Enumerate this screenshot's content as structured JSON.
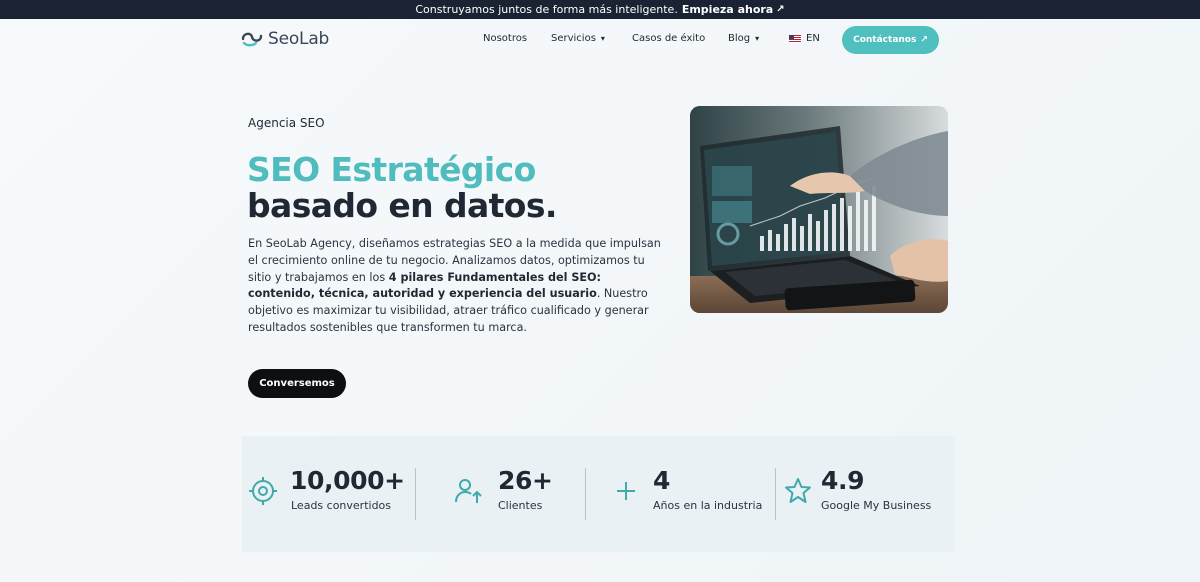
{
  "announcement": {
    "text": "Construyamos juntos de forma más inteligente.",
    "cta": "Empieza ahora",
    "cta_arrow": "↗"
  },
  "header": {
    "logo_text": "SeoLab",
    "nav": [
      {
        "label": "Nosotros"
      },
      {
        "label": "Servicios",
        "dropdown": true
      },
      {
        "label": "Casos de éxito"
      },
      {
        "label": "Blog",
        "dropdown": true
      }
    ],
    "language": "EN",
    "contact_label": "Contáctanos",
    "contact_arrow": "↗",
    "caret": "▾"
  },
  "hero": {
    "eyebrow": "Agencia SEO",
    "title_line1": "SEO Estratégico",
    "title_line2": "basado en datos.",
    "paragraph": {
      "part1": "En SeoLab Agency, diseñamos estrategias SEO a la medida que impulsan el crecimiento online de tu negocio. Analizamos datos, optimizamos tu sitio y trabajamos en los ",
      "bold": "4 pilares Fundamentales del SEO: contenido, técnica, autoridad y experiencia del usuario",
      "part2": ". Nuestro objetivo es maximizar tu visibilidad, atraer tráfico cualificado y generar resultados sostenibles que transformen tu marca."
    },
    "button": "Conversemos"
  },
  "stats": [
    {
      "value": "10,000+",
      "label": "Leads convertidos",
      "icon": "target-icon"
    },
    {
      "value": "26+",
      "label": "Clientes",
      "icon": "users-growth-icon"
    },
    {
      "value": "4",
      "label": "Años en la industria",
      "icon": "plus-icon"
    },
    {
      "value": "4.9",
      "label": "Google My Business",
      "icon": "star-icon"
    }
  ],
  "colors": {
    "accent": "#4fbfc0",
    "dark": "#1a2333",
    "text": "#1f2833"
  }
}
